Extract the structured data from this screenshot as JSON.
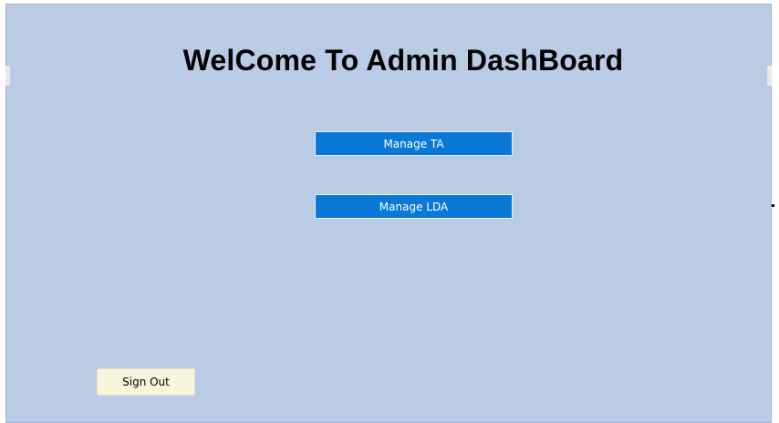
{
  "dashboard": {
    "title": "WelCome To Admin DashBoard",
    "buttons": {
      "manage_ta": "Manage TA",
      "manage_lda": "Manage LDA",
      "sign_out": "Sign Out"
    }
  },
  "colors": {
    "background": "#b9cbe5",
    "primary_button": "#0a78d6",
    "sign_out_button": "#f8f4dc"
  }
}
